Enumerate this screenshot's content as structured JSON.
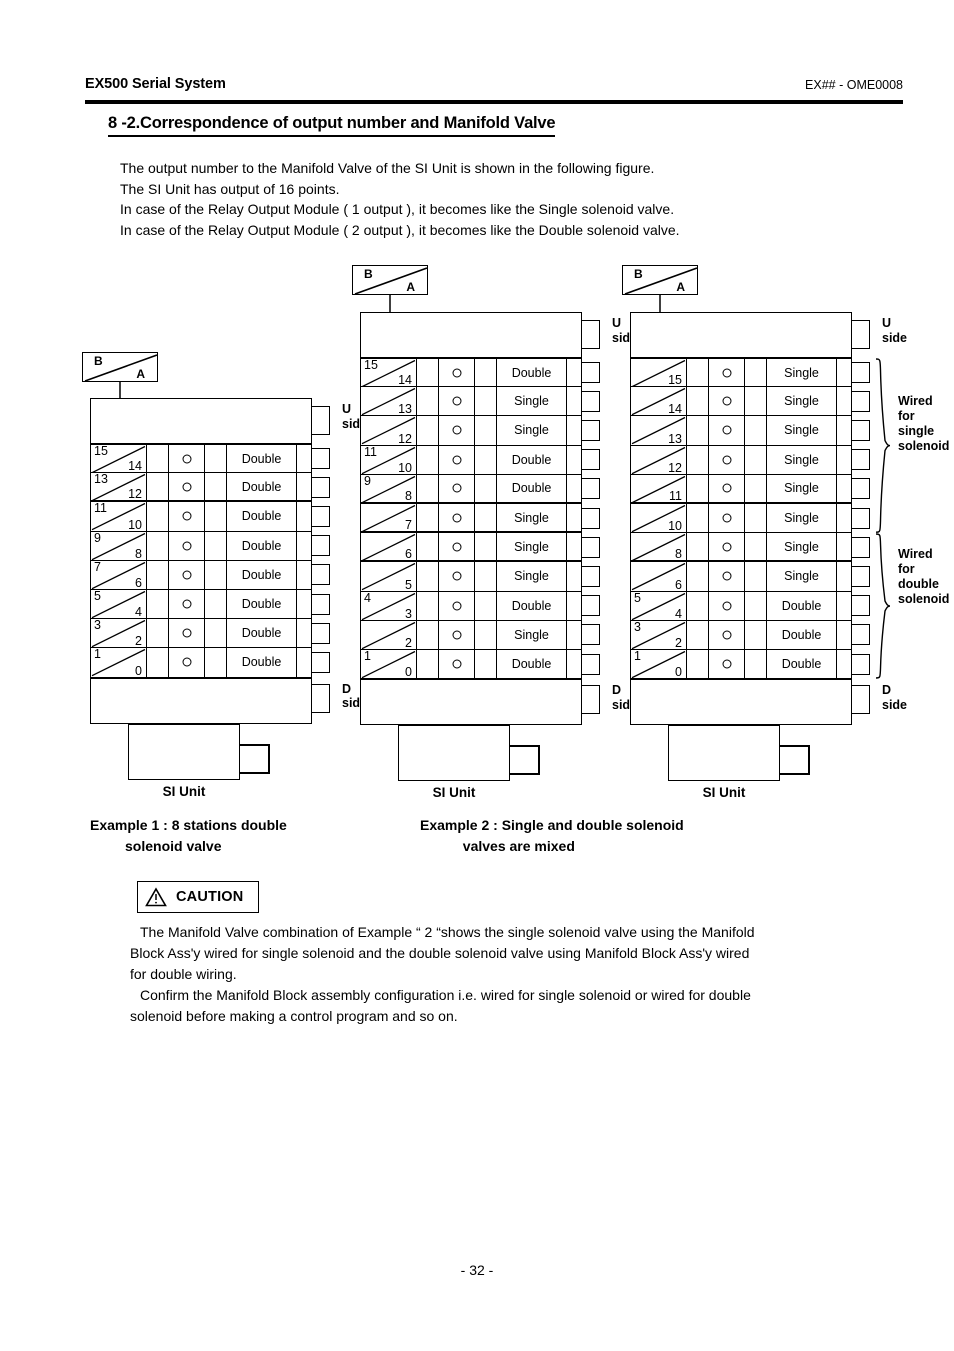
{
  "header": {
    "left": "EX500 Serial System",
    "right": "EX## - OME0008"
  },
  "section": {
    "title": "8 -2.Correspondence of output number and Manifold Valve"
  },
  "intro": {
    "line1": "The output number to the Manifold Valve of the SI Unit is shown in the following figure.",
    "line2": "The SI Unit has output of 16 points.",
    "line3": "In case of the Relay Output Module ( 1 output ), it becomes like the Single solenoid valve.",
    "line4": "In case of the Relay Output Module ( 2 output ), it becomes like the Double solenoid valve."
  },
  "legend": {
    "b": "B",
    "a": "A"
  },
  "labels": {
    "u_side_line1": "U",
    "u_side_line2": "side",
    "d_side_line1": "D",
    "d_side_line2": "side",
    "si_unit": "SI Unit",
    "wired_single": "Wired\nfor\nsingle\nsolenoid",
    "wired_double": "Wired\nfor\ndouble\nsolenoid"
  },
  "diagrams": [
    {
      "name": "example-1-manifold",
      "stations": [
        {
          "b": "15",
          "a": "14",
          "type": "Double"
        },
        {
          "b": "13",
          "a": "12",
          "type": "Double"
        },
        {
          "b": "11",
          "a": "10",
          "type": "Double"
        },
        {
          "b": "9",
          "a": "8",
          "type": "Double"
        },
        {
          "b": "7",
          "a": "6",
          "type": "Double"
        },
        {
          "b": "5",
          "a": "4",
          "type": "Double"
        },
        {
          "b": "3",
          "a": "2",
          "type": "Double"
        },
        {
          "b": "1",
          "a": "0",
          "type": "Double"
        }
      ]
    },
    {
      "name": "example-2-manifold-left",
      "stations": [
        {
          "b": "15",
          "a": "14",
          "type": "Double"
        },
        {
          "b": "",
          "a": "13",
          "type": "Single"
        },
        {
          "b": "",
          "a": "12",
          "type": "Single"
        },
        {
          "b": "11",
          "a": "10",
          "type": "Double"
        },
        {
          "b": "9",
          "a": "8",
          "type": "Double"
        },
        {
          "b": "",
          "a": "7",
          "type": "Single"
        },
        {
          "b": "",
          "a": "6",
          "type": "Single"
        },
        {
          "b": "",
          "a": "5",
          "type": "Single"
        },
        {
          "b": "4",
          "a": "3",
          "type": "Double"
        },
        {
          "b": "",
          "a": "2",
          "type": "Single"
        },
        {
          "b": "1",
          "a": "0",
          "type": "Double"
        }
      ]
    },
    {
      "name": "example-2-manifold-right",
      "stations": [
        {
          "b": "",
          "a": "15",
          "type": "Single"
        },
        {
          "b": "",
          "a": "14",
          "type": "Single"
        },
        {
          "b": "",
          "a": "13",
          "type": "Single"
        },
        {
          "b": "",
          "a": "12",
          "type": "Single"
        },
        {
          "b": "",
          "a": "11",
          "type": "Single"
        },
        {
          "b": "",
          "a": "10",
          "type": "Single"
        },
        {
          "b": "",
          "a": "8",
          "type": "Single"
        },
        {
          "b": "",
          "a": "6",
          "type": "Single"
        },
        {
          "b": "5",
          "a": "4",
          "type": "Double"
        },
        {
          "b": "3",
          "a": "2",
          "type": "Double"
        },
        {
          "b": "1",
          "a": "0",
          "type": "Double"
        }
      ]
    }
  ],
  "examples": {
    "caption1": "Example 1 : 8 stations double\n         solenoid valve",
    "caption2": "Example 2 : Single and double solenoid\n           valves are mixed"
  },
  "caution": {
    "title": "CAUTION",
    "line1": "The Manifold Valve combination of Example “ 2 “shows the single solenoid valve using the Manifold",
    "line2": "Block Ass'y wired for single solenoid and the double solenoid valve using Manifold Block Ass'y wired",
    "line3": "for double wiring.",
    "line4": "Confirm the Manifold Block assembly configuration i.e. wired for single solenoid or wired for double",
    "line5": "solenoid before making a control program and so on."
  },
  "footer": {
    "page": "- 32 -"
  }
}
